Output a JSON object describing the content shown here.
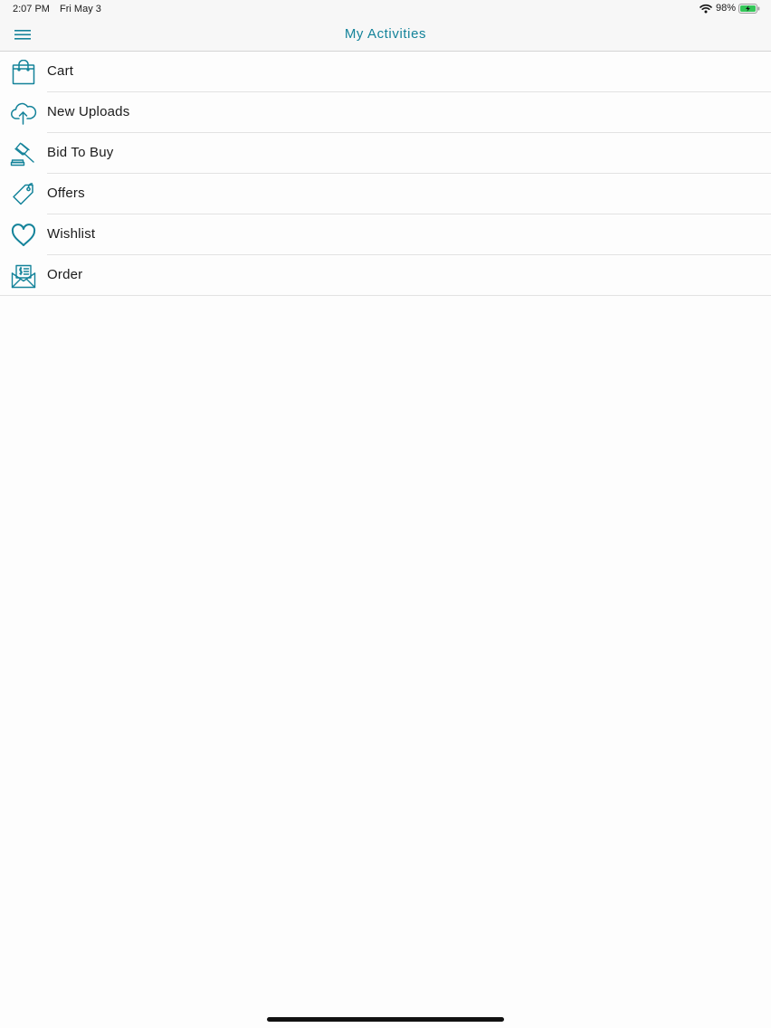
{
  "status_bar": {
    "time": "2:07 PM",
    "date": "Fri May 3",
    "battery_percent": "98%",
    "battery_level": 0.98,
    "wifi_icon": "wifi-icon",
    "battery_icon": "battery-charging-icon"
  },
  "nav": {
    "title": "My Activities",
    "menu_icon": "hamburger-menu-icon"
  },
  "colors": {
    "accent": "#14839a",
    "background": "#fdfdfd",
    "bar_background": "#f7f7f7",
    "battery_green": "#34c759"
  },
  "activities": [
    {
      "label": "Cart",
      "icon": "shopping-bag-icon"
    },
    {
      "label": "New Uploads",
      "icon": "cloud-upload-icon"
    },
    {
      "label": "Bid To Buy",
      "icon": "gavel-icon"
    },
    {
      "label": "Offers",
      "icon": "price-tag-icon"
    },
    {
      "label": "Wishlist",
      "icon": "heart-icon"
    },
    {
      "label": "Order",
      "icon": "order-envelope-icon"
    }
  ]
}
